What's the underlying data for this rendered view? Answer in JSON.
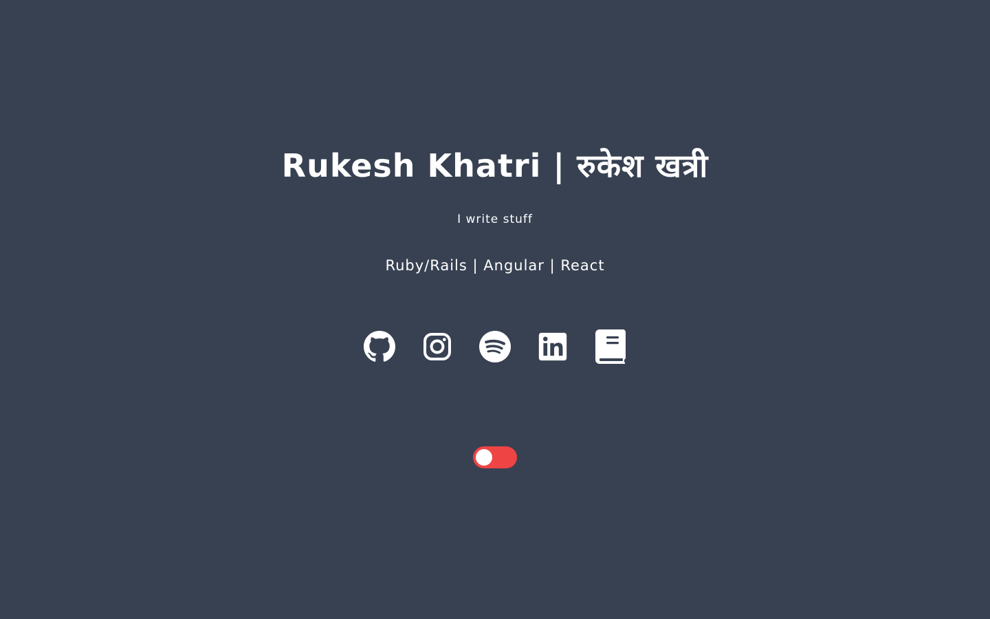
{
  "header": {
    "title": "Rukesh Khatri | रुकेश खत्री",
    "tagline": "I write stuff",
    "stack": "Ruby/Rails | Angular | React"
  },
  "social_links": [
    {
      "icon": "github-icon"
    },
    {
      "icon": "instagram-icon"
    },
    {
      "icon": "spotify-icon"
    },
    {
      "icon": "linkedin-icon"
    },
    {
      "icon": "book-icon"
    }
  ],
  "theme_toggle": {
    "state": "off",
    "color": "#ef4444"
  },
  "colors": {
    "background": "#384152",
    "text": "#ffffff"
  }
}
